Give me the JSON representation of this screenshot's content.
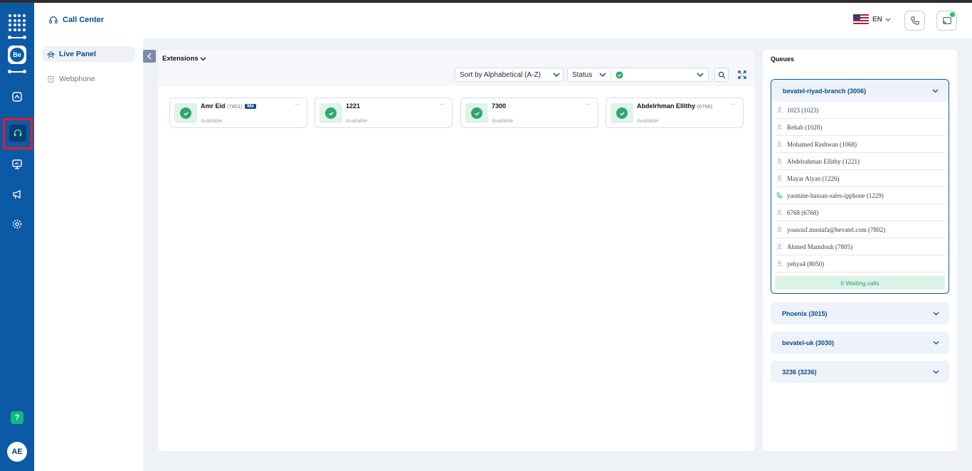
{
  "app": {
    "section_title": "Call Center",
    "user_initials": "AE",
    "help_label": "?",
    "brand_label": "Be"
  },
  "nav": {
    "items": [
      {
        "label": "Live Panel",
        "icon": "live-panel-icon",
        "active": true
      },
      {
        "label": "Webphone",
        "icon": "webphone-icon",
        "active": false
      }
    ]
  },
  "header": {
    "language": "EN"
  },
  "extensions": {
    "title": "Extensions",
    "sort_label": "Sort by Alphabetical (A-Z)",
    "status_label": "Status",
    "items": [
      {
        "name": "Amr Eid",
        "number": "(7801)",
        "badge": "Me",
        "status": "Available"
      },
      {
        "name": "1221",
        "number": "",
        "badge": "",
        "status": "Available"
      },
      {
        "name": "7300",
        "number": "",
        "badge": "",
        "status": "Available"
      },
      {
        "name": "Abdelrhman Ellithy",
        "number": "(6766)",
        "badge": "",
        "status": "Available"
      }
    ]
  },
  "queues": {
    "title": "Queues",
    "open": {
      "name": "bevatel-riyad-branch (3006)",
      "members": [
        {
          "label": "1023 (1023)",
          "icon": "user-icon"
        },
        {
          "label": "Rehab (1028)",
          "icon": "user-icon"
        },
        {
          "label": "Mohamed Rashwan (1068)",
          "icon": "user-icon"
        },
        {
          "label": "Abdelrahman Ellithy (1221)",
          "icon": "user-icon"
        },
        {
          "label": "Mayar Alyan (1226)",
          "icon": "user-icon"
        },
        {
          "label": "yasmine-hassan-sales-ipphone (1229)",
          "icon": "phone-icon"
        },
        {
          "label": "6768 (6768)",
          "icon": "user-icon"
        },
        {
          "label": "yousouf.mustafa@bevatel.com (7802)",
          "icon": "user-icon"
        },
        {
          "label": "Ahmed Mamdouh (7805)",
          "icon": "user-icon"
        },
        {
          "label": "yehya4 (8050)",
          "icon": "user-icon"
        }
      ],
      "waiting": "0 Waiting calls"
    },
    "closed": [
      {
        "name": "Phoenix (3015)"
      },
      {
        "name": "bevatel-uk (3030)"
      },
      {
        "name": "3236 (3236)"
      }
    ]
  },
  "colors": {
    "rail": "#0c5aa6",
    "accent": "#0c4a8a",
    "available": "#2fa66f",
    "highlight": "#e11d2a"
  }
}
